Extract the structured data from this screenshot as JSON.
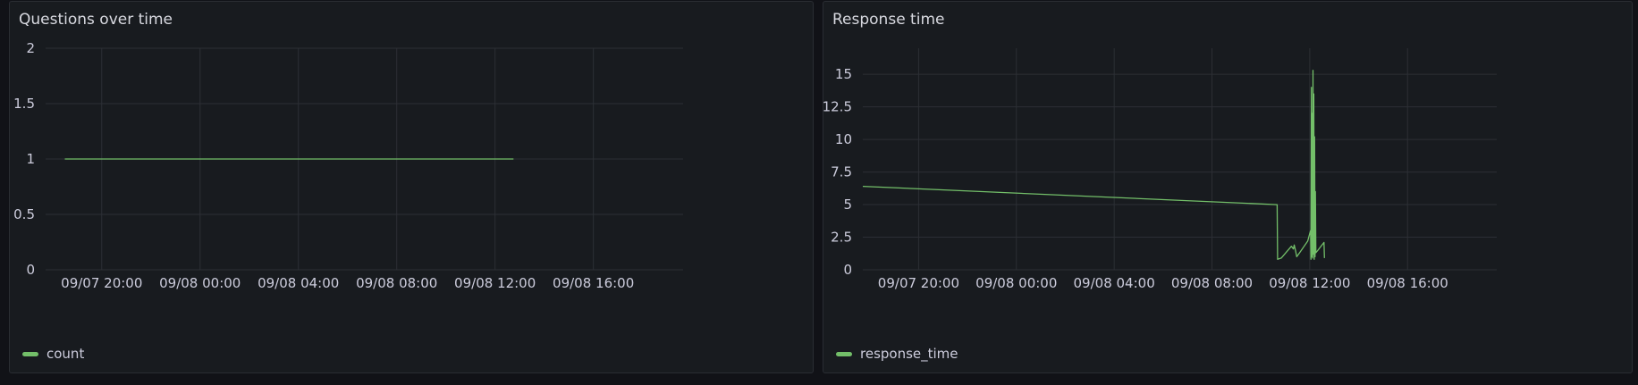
{
  "colors": {
    "background": "#111217",
    "panel": "#181b1f",
    "grid": "#2c2f35",
    "series": "#73bf69"
  },
  "panels": [
    {
      "title": "Questions over time",
      "legend": "count"
    },
    {
      "title": "Response time",
      "legend": "response_time"
    }
  ],
  "chart_data": [
    {
      "type": "line",
      "title": "Questions over time",
      "xlabel": "",
      "ylabel": "",
      "xlim": [
        "09/07 17:43",
        "09/08 19:39"
      ],
      "ylim": [
        0,
        2
      ],
      "x_ticks": [
        "09/07 20:00",
        "09/08 00:00",
        "09/08 04:00",
        "09/08 08:00",
        "09/08 12:00",
        "09/08 16:00"
      ],
      "y_ticks": [
        "0",
        "0.5",
        "1",
        "1.5",
        "2"
      ],
      "grid": true,
      "legend_position": "bottom-left",
      "series": [
        {
          "name": "count",
          "color": "#73bf69",
          "x": [
            "09/07 18:30",
            "09/08 12:45"
          ],
          "y": [
            1,
            1
          ]
        }
      ]
    },
    {
      "type": "line",
      "title": "Response time",
      "xlabel": "",
      "ylabel": "",
      "xlim": [
        "09/07 17:43",
        "09/08 19:39"
      ],
      "ylim": [
        0,
        17
      ],
      "x_ticks": [
        "09/07 20:00",
        "09/08 00:00",
        "09/08 04:00",
        "09/08 08:00",
        "09/08 12:00",
        "09/08 16:00"
      ],
      "y_ticks": [
        "0",
        "2.5",
        "5",
        "7.5",
        "10",
        "12.5",
        "15"
      ],
      "grid": true,
      "legend_position": "bottom-left",
      "series": [
        {
          "name": "response_time",
          "color": "#73bf69",
          "x": [
            "09/07 17:43",
            "09/08 10:40",
            "09/08 10:41",
            "09/08 10:50",
            "09/08 11:15",
            "09/08 11:20",
            "09/08 11:22",
            "09/08 11:25",
            "09/08 11:28",
            "09/08 11:35",
            "09/08 11:55",
            "09/08 12:00",
            "09/08 12:02",
            "09/08 12:03",
            "09/08 12:04",
            "09/08 12:05",
            "09/08 12:06",
            "09/08 12:07",
            "09/08 12:08",
            "09/08 12:09",
            "09/08 12:10",
            "09/08 12:11",
            "09/08 12:12",
            "09/08 12:13",
            "09/08 12:14",
            "09/08 12:15",
            "09/08 12:20",
            "09/08 12:35",
            "09/08 12:36"
          ],
          "y": [
            6.4,
            5.0,
            0.8,
            0.9,
            1.8,
            1.6,
            1.9,
            1.5,
            1.0,
            1.3,
            2.2,
            2.8,
            3.0,
            0.8,
            14.0,
            1.0,
            12.0,
            0.9,
            15.3,
            1.2,
            13.5,
            0.8,
            10.2,
            1.0,
            6.0,
            1.3,
            1.5,
            2.1,
            0.9
          ]
        }
      ]
    }
  ]
}
